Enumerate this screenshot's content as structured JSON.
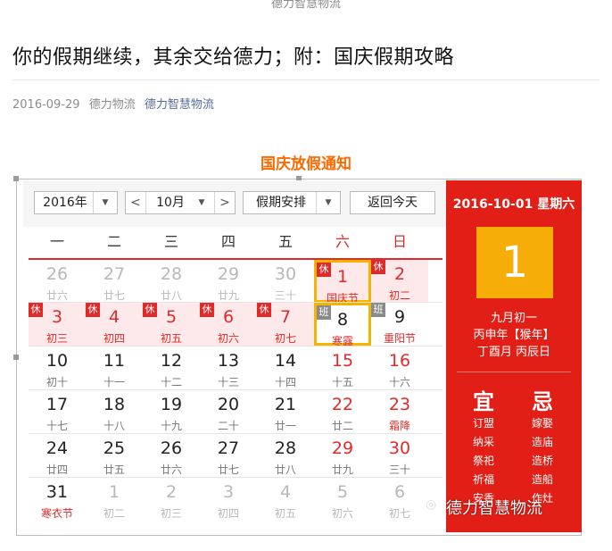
{
  "header": {
    "top_cut": "德力智慧物流"
  },
  "article": {
    "title": "你的假期继续，其余交给德力；附：国庆假期攻略",
    "date": "2016-09-29",
    "author": "德力物流",
    "account": "德力智慧物流"
  },
  "notice": "国庆放假通知",
  "calendar": {
    "year_select": "2016年",
    "month_select": "10月",
    "prev_arrow": "<",
    "next_arrow": ">",
    "holiday_select": "假期安排",
    "today_button": "返回今天",
    "weekdays": [
      "一",
      "二",
      "三",
      "四",
      "五",
      "六",
      "日"
    ],
    "weeks": [
      [
        {
          "n": "26",
          "l": "廿六",
          "cls": "other"
        },
        {
          "n": "27",
          "l": "廿七",
          "cls": "other"
        },
        {
          "n": "28",
          "l": "廿八",
          "cls": "other"
        },
        {
          "n": "29",
          "l": "廿九",
          "cls": "other"
        },
        {
          "n": "30",
          "l": "三十",
          "cls": "other"
        },
        {
          "n": "1",
          "l": "国庆节",
          "cls": "holiday boxed",
          "tag": "休"
        },
        {
          "n": "2",
          "l": "初二",
          "cls": "holiday",
          "tag": "休"
        }
      ],
      [
        {
          "n": "3",
          "l": "初三",
          "cls": "holiday",
          "tag": "休"
        },
        {
          "n": "4",
          "l": "初四",
          "cls": "holiday",
          "tag": "休"
        },
        {
          "n": "5",
          "l": "初五",
          "cls": "holiday",
          "tag": "休"
        },
        {
          "n": "6",
          "l": "初六",
          "cls": "holiday",
          "tag": "休"
        },
        {
          "n": "7",
          "l": "初七",
          "cls": "holiday",
          "tag": "休"
        },
        {
          "n": "8",
          "l": "寒露",
          "cls": "wkend hl boxed",
          "tag": "班",
          "tagcls": "ban"
        },
        {
          "n": "9",
          "l": "重阳节",
          "cls": "wkend hl",
          "tag": "班",
          "tagcls": "ban"
        }
      ],
      [
        {
          "n": "10",
          "l": "初十"
        },
        {
          "n": "11",
          "l": "十一"
        },
        {
          "n": "12",
          "l": "十二"
        },
        {
          "n": "13",
          "l": "十三"
        },
        {
          "n": "14",
          "l": "十四"
        },
        {
          "n": "15",
          "l": "十五",
          "cls": "wkend"
        },
        {
          "n": "16",
          "l": "十六",
          "cls": "wkend"
        }
      ],
      [
        {
          "n": "17",
          "l": "十七"
        },
        {
          "n": "18",
          "l": "十八"
        },
        {
          "n": "19",
          "l": "十九"
        },
        {
          "n": "20",
          "l": "二十"
        },
        {
          "n": "21",
          "l": "廿一"
        },
        {
          "n": "22",
          "l": "廿二",
          "cls": "wkend"
        },
        {
          "n": "23",
          "l": "霜降",
          "cls": "wkend fest"
        }
      ],
      [
        {
          "n": "24",
          "l": "廿四"
        },
        {
          "n": "25",
          "l": "廿五"
        },
        {
          "n": "26",
          "l": "廿六"
        },
        {
          "n": "27",
          "l": "廿七"
        },
        {
          "n": "28",
          "l": "廿八"
        },
        {
          "n": "29",
          "l": "廿九",
          "cls": "wkend"
        },
        {
          "n": "30",
          "l": "三十",
          "cls": "wkend"
        }
      ],
      [
        {
          "n": "31",
          "l": "寒衣节",
          "cls": "fest"
        },
        {
          "n": "1",
          "l": "初二",
          "cls": "other"
        },
        {
          "n": "2",
          "l": "初三",
          "cls": "other"
        },
        {
          "n": "3",
          "l": "初四",
          "cls": "other"
        },
        {
          "n": "4",
          "l": "初五",
          "cls": "other"
        },
        {
          "n": "5",
          "l": "初六",
          "cls": "other"
        },
        {
          "n": "6",
          "l": "初七",
          "cls": "other"
        }
      ]
    ],
    "side": {
      "date": "2016-10-01 星期六",
      "day": "1",
      "lunar": "九月初一",
      "ganzhi_year": "丙申年【猴年】",
      "ganzhi_day": "丁酉月 丙辰日",
      "yi_label": "宜",
      "ji_label": "忌",
      "yi": [
        "订盟",
        "纳采",
        "祭祀",
        "祈福",
        "安香"
      ],
      "ji": [
        "嫁娶",
        "造庙",
        "造桥",
        "造船",
        "作灶"
      ]
    },
    "watermark": "德力智慧物流"
  },
  "colors": {
    "accent_red": "#e21f16",
    "highlight_gold": "#f7ad08",
    "notice_orange": "#ff6a00"
  }
}
